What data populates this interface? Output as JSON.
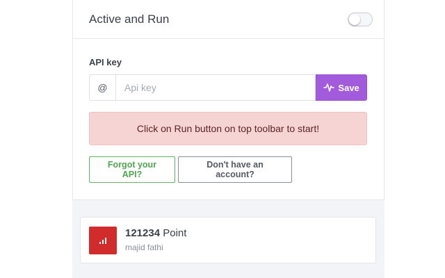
{
  "header": {
    "title": "Active and Run",
    "toggle_on": false
  },
  "api": {
    "label": "API key",
    "prefix": "@",
    "input_value": "",
    "placeholder": "Api key",
    "save_label": "Save",
    "save_icon": "pulse-icon",
    "save_color": "#a25bdb"
  },
  "alert": {
    "message": "Click on Run button on top toolbar to start!",
    "bg_color": "#f7d4d4"
  },
  "actions": {
    "forgot_label": "Forgot your API?",
    "no_account_label": "Don't have an account?"
  },
  "points": {
    "value": "121234",
    "unit": "Point",
    "user": "majid fathi",
    "icon": "bar-chart-icon",
    "icon_color": "#d12b2b"
  }
}
